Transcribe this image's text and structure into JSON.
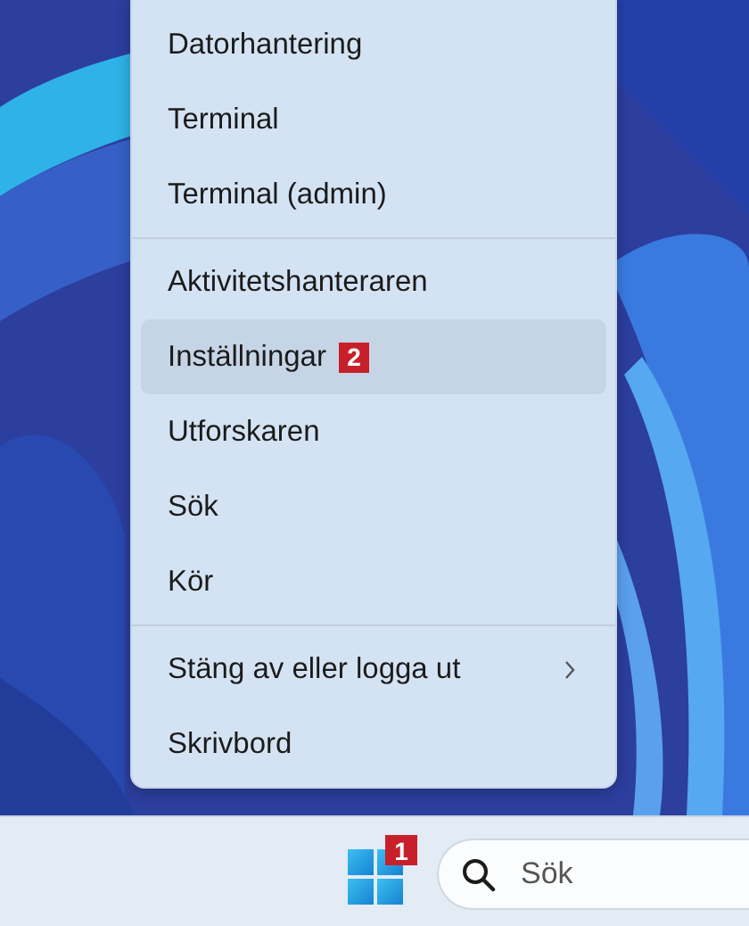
{
  "menu": {
    "sections": [
      {
        "items": [
          {
            "label": "Datorhantering",
            "selected": false
          },
          {
            "label": "Terminal",
            "selected": false
          },
          {
            "label": "Terminal (admin)",
            "selected": false
          }
        ]
      },
      {
        "items": [
          {
            "label": "Aktivitetshanteraren",
            "selected": false
          },
          {
            "label": "Inställningar",
            "selected": true,
            "badge": "2"
          },
          {
            "label": "Utforskaren",
            "selected": false
          },
          {
            "label": "Sök",
            "selected": false
          },
          {
            "label": "Kör",
            "selected": false
          }
        ]
      },
      {
        "items": [
          {
            "label": "Stäng av eller logga ut",
            "selected": false,
            "submenu": true
          },
          {
            "label": "Skrivbord",
            "selected": false
          }
        ]
      }
    ]
  },
  "taskbar": {
    "start_badge": "1",
    "search": {
      "placeholder": "Sök"
    }
  }
}
